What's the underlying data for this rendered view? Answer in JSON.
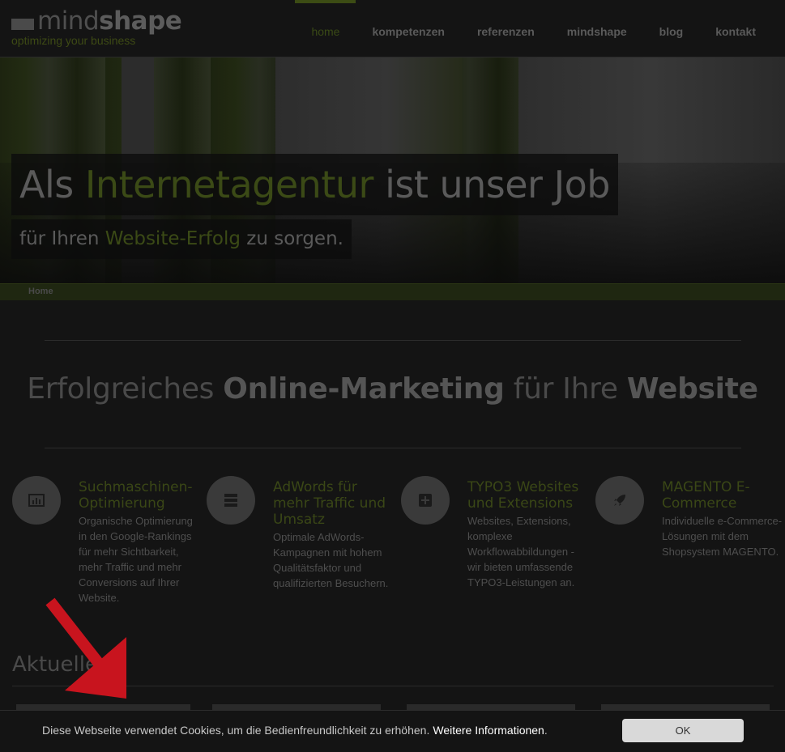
{
  "header": {
    "logo_text_light": "mind",
    "logo_text_bold": "shape",
    "logo_tagline": "optimizing your business",
    "nav": [
      {
        "label": "home",
        "active": true
      },
      {
        "label": "kompetenzen",
        "active": false
      },
      {
        "label": "referenzen",
        "active": false
      },
      {
        "label": "mindshape",
        "active": false
      },
      {
        "label": "blog",
        "active": false
      },
      {
        "label": "kontakt",
        "active": false
      }
    ]
  },
  "hero": {
    "title_part1": "Als ",
    "title_highlight": "Internetagentur",
    "title_part2": " ist unser Job",
    "sub_part1": "für Ihren ",
    "sub_highlight": "Website-Erfolg",
    "sub_part2": " zu sorgen."
  },
  "breadcrumb": {
    "label": "Home"
  },
  "headline": {
    "part1": "Erfolgreiches ",
    "bold1": "Online-Marketing",
    "part2": " für Ihre ",
    "bold2": "Website"
  },
  "services": [
    {
      "icon": "chart-icon",
      "title": "Suchmaschinen-Optimierung",
      "text": "Organische Optimierung in den Google-Rankings für mehr Sichtbarkeit, mehr Traffic und mehr Conversions auf Ihrer Website."
    },
    {
      "icon": "server-icon",
      "title": "AdWords für mehr Traffic und Umsatz",
      "text": "Optimale AdWords-Kampagnen mit hohem Qualitätsfaktor und qualifizierten Besuchern."
    },
    {
      "icon": "plus-square-icon",
      "title": "TYPO3 Websites und Extensions",
      "text": "Websites, Extensions, komplexe Workflowabbildungen - wir bieten umfassende TYPO3-Leistungen an."
    },
    {
      "icon": "rocket-icon",
      "title": "MAGENTO E-Commerce",
      "text": "Individuelle e-Commerce-Lösungen mit dem Shopsystem MAGENTO."
    }
  ],
  "aktuelles": {
    "title": "Aktuelles"
  },
  "cookie": {
    "text": "Diese Webseite verwendet Cookies, um die Bedienfreundlichkeit zu erhöhen.",
    "link": "Weitere Informationen",
    "link_suffix": ".",
    "button": "OK"
  },
  "colors": {
    "accent": "#3b4a16",
    "arrow": "#c8141e",
    "cookie_bar": "#141414"
  }
}
